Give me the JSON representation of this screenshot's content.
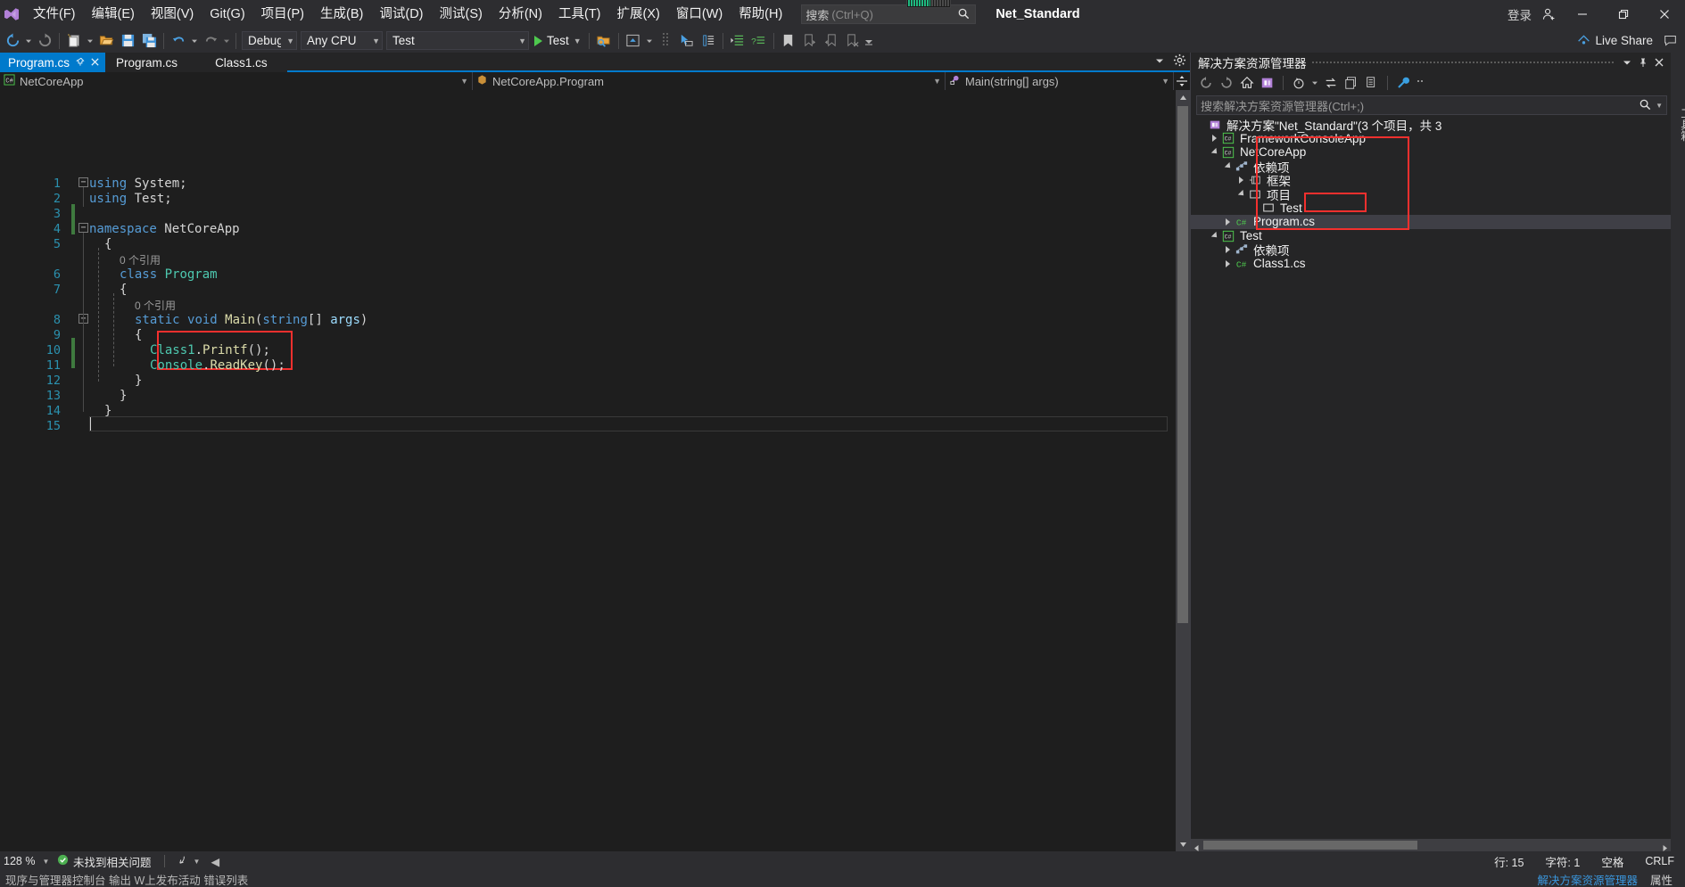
{
  "titlebar": {
    "menu": [
      {
        "label": "文件(F)"
      },
      {
        "label": "编辑(E)"
      },
      {
        "label": "视图(V)"
      },
      {
        "label": "Git(G)"
      },
      {
        "label": "项目(P)"
      },
      {
        "label": "生成(B)"
      },
      {
        "label": "调试(D)"
      },
      {
        "label": "测试(S)"
      },
      {
        "label": "分析(N)"
      },
      {
        "label": "工具(T)"
      },
      {
        "label": "扩展(X)"
      },
      {
        "label": "窗口(W)"
      },
      {
        "label": "帮助(H)"
      }
    ],
    "search_placeholder_cn": "搜索",
    "search_placeholder_key": "(Ctrl+Q)",
    "app_title": "Net_Standard",
    "signin_label": "登录",
    "minimize": "—",
    "restore": "❐",
    "close": "✕"
  },
  "toolbar": {
    "config": "Debug",
    "platform": "Any CPU",
    "startup_project": "Test",
    "run_label": "Test",
    "liveshare_label": "Live Share"
  },
  "editor": {
    "tabs": [
      {
        "label": "Program.cs",
        "active": true
      },
      {
        "label": "Program.cs",
        "active": false
      },
      {
        "label": "Class1.cs",
        "active": false
      }
    ],
    "nav": {
      "project": "NetCoreApp",
      "type": "NetCoreApp.Program",
      "member": "Main(string[] args)"
    },
    "line_numbers": [
      "1",
      "2",
      "3",
      "4",
      "5",
      "6",
      "7",
      "8",
      "9",
      "10",
      "11",
      "12",
      "13",
      "14",
      "15"
    ],
    "code_lines": [
      {
        "n": 1,
        "indent": 0,
        "tokens": [
          {
            "t": "k",
            "v": "using"
          },
          {
            "t": "pn",
            "v": " System;"
          }
        ]
      },
      {
        "n": 2,
        "indent": 0,
        "tokens": [
          {
            "t": "k",
            "v": "using"
          },
          {
            "t": "pn",
            "v": " Test;"
          }
        ]
      },
      {
        "n": 3,
        "indent": 0,
        "tokens": []
      },
      {
        "n": 4,
        "indent": 0,
        "tokens": [
          {
            "t": "k",
            "v": "namespace"
          },
          {
            "t": "pn",
            "v": " NetCoreApp"
          }
        ]
      },
      {
        "n": 5,
        "indent": 1,
        "tokens": [
          {
            "t": "pn",
            "v": "{"
          }
        ]
      },
      {
        "n": 0,
        "indent": 2,
        "tokens": [
          {
            "t": "cref",
            "v": "0 个引用"
          }
        ]
      },
      {
        "n": 6,
        "indent": 2,
        "tokens": [
          {
            "t": "k",
            "v": "class"
          },
          {
            "t": "t",
            "v": " Program"
          }
        ]
      },
      {
        "n": 7,
        "indent": 2,
        "tokens": [
          {
            "t": "pn",
            "v": "{"
          }
        ]
      },
      {
        "n": 0,
        "indent": 3,
        "tokens": [
          {
            "t": "cref",
            "v": "0 个引用"
          }
        ]
      },
      {
        "n": 8,
        "indent": 3,
        "tokens": [
          {
            "t": "k",
            "v": "static"
          },
          {
            "t": "pn",
            "v": " "
          },
          {
            "t": "k",
            "v": "void"
          },
          {
            "t": "pn",
            "v": " "
          },
          {
            "t": "m",
            "v": "Main"
          },
          {
            "t": "pn",
            "v": "("
          },
          {
            "t": "k",
            "v": "string"
          },
          {
            "t": "pn",
            "v": "[] "
          },
          {
            "t": "p",
            "v": "args"
          },
          {
            "t": "pn",
            "v": ")"
          }
        ]
      },
      {
        "n": 9,
        "indent": 3,
        "tokens": [
          {
            "t": "pn",
            "v": "{"
          }
        ]
      },
      {
        "n": 10,
        "indent": 4,
        "tokens": [
          {
            "t": "t",
            "v": "Class1"
          },
          {
            "t": "pn",
            "v": "."
          },
          {
            "t": "m",
            "v": "Printf"
          },
          {
            "t": "pn",
            "v": "();"
          }
        ]
      },
      {
        "n": 11,
        "indent": 4,
        "tokens": [
          {
            "t": "t",
            "v": "Console"
          },
          {
            "t": "pn",
            "v": "."
          },
          {
            "t": "m",
            "v": "ReadKey"
          },
          {
            "t": "pn",
            "v": "();"
          }
        ]
      },
      {
        "n": 12,
        "indent": 3,
        "tokens": [
          {
            "t": "pn",
            "v": "}"
          }
        ]
      },
      {
        "n": 13,
        "indent": 2,
        "tokens": [
          {
            "t": "pn",
            "v": "}"
          }
        ]
      },
      {
        "n": 14,
        "indent": 1,
        "tokens": [
          {
            "t": "pn",
            "v": "}"
          }
        ]
      },
      {
        "n": 15,
        "indent": 0,
        "tokens": []
      }
    ],
    "highlight_box_label": "code-highlight-box"
  },
  "solution_explorer": {
    "title": "解决方案资源管理器",
    "search_placeholder": "搜索解决方案资源管理器(Ctrl+;)",
    "tree": [
      {
        "depth": 0,
        "label": "解决方案\"Net_Standard\"(3 个项目，共 3",
        "twisty": "none",
        "icon": "solution-icon",
        "selected": false
      },
      {
        "depth": 1,
        "label": "FrameworkConsoleApp",
        "twisty": "collapsed",
        "icon": "csharp-project-icon",
        "selected": false
      },
      {
        "depth": 1,
        "label": "NetCoreApp",
        "twisty": "expanded",
        "icon": "csharp-project-icon",
        "selected": false
      },
      {
        "depth": 2,
        "label": "依赖项",
        "twisty": "expanded",
        "icon": "dependencies-icon",
        "selected": false
      },
      {
        "depth": 3,
        "label": "框架",
        "twisty": "collapsed",
        "icon": "framework-icon",
        "selected": false
      },
      {
        "depth": 3,
        "label": "项目",
        "twisty": "expanded",
        "icon": "projects-icon",
        "selected": false
      },
      {
        "depth": 4,
        "label": "Test",
        "twisty": "none",
        "icon": "project-ref-icon",
        "selected": false
      },
      {
        "depth": 2,
        "label": "Program.cs",
        "twisty": "collapsed",
        "icon": "csharp-file-icon",
        "selected": true
      },
      {
        "depth": 1,
        "label": "Test",
        "twisty": "expanded",
        "icon": "csharp-project-icon",
        "selected": false
      },
      {
        "depth": 2,
        "label": "依赖项",
        "twisty": "collapsed",
        "icon": "dependencies-icon",
        "selected": false
      },
      {
        "depth": 2,
        "label": "Class1.cs",
        "twisty": "collapsed",
        "icon": "csharp-file-icon",
        "selected": false
      }
    ],
    "bottom_tabs": [
      {
        "label": "解决方案资源管理器",
        "active": true
      },
      {
        "label": "属性",
        "active": false
      }
    ],
    "toolwindow_vertical_label": "工具箱"
  },
  "statusbar": {
    "zoom": "128 %",
    "issues": "未找到相关问题",
    "line_label": "行: 15",
    "col_label": "字符: 1",
    "space_label": "空格",
    "eol_label": "CRLF",
    "bottom_text": "现序与管理器控制台    输出    W上发布活动    错误列表"
  },
  "colors": {
    "accent": "#007acc",
    "chrome": "#2d2d30",
    "editor_bg": "#1e1e1e",
    "panel_bg": "#252526",
    "highlight_red": "#f4302e",
    "keyword": "#569cd6",
    "type": "#4ec9b0",
    "method": "#dcdcaa",
    "param": "#9cdcfe",
    "linenumber": "#2b91af"
  }
}
